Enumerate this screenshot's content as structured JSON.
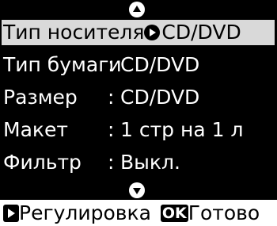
{
  "menu": {
    "items": [
      {
        "label": "Тип носителя",
        "value": "CD/DVD"
      },
      {
        "label": "Тип бумаги",
        "value": "CD/DVD"
      },
      {
        "label": "Размер",
        "value": "CD/DVD"
      },
      {
        "label": "Макет",
        "value": "1 стр на 1 л"
      },
      {
        "label": "Фильтр",
        "value": "Выкл."
      }
    ],
    "separator": ":"
  },
  "footer": {
    "adjust_label": "Регулировка",
    "ok_key": "OK",
    "done_label": "Готово"
  },
  "icons": {
    "scroll_up": "scroll-up-icon",
    "scroll_down": "scroll-down-icon",
    "right_arrow": "right-arrow-icon"
  },
  "colors": {
    "background": "#000000",
    "highlight": "#d9d9d9",
    "text": "#ffffff"
  }
}
